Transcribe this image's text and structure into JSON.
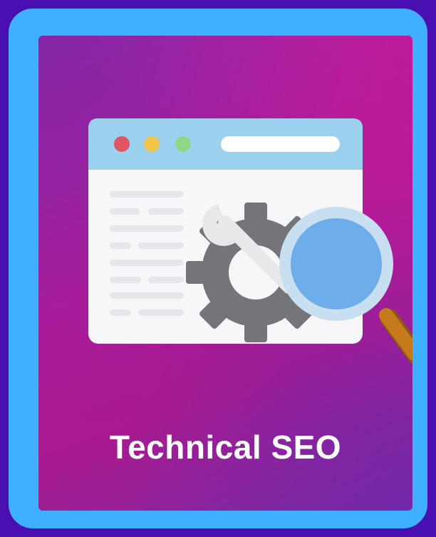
{
  "card": {
    "title": "Technical SEO"
  },
  "illustration": {
    "browser_dots": [
      "#e05563",
      "#f2c64a",
      "#8fd88a"
    ],
    "browser_bar_color": "#9bd0ee",
    "gear_color": "#737579",
    "wrench_color": "#e6e8ea",
    "lens_color": "#6daeea",
    "handle_color": "#c77a1c",
    "icons": [
      "browser-window",
      "gear",
      "wrench",
      "magnifying-glass"
    ]
  }
}
